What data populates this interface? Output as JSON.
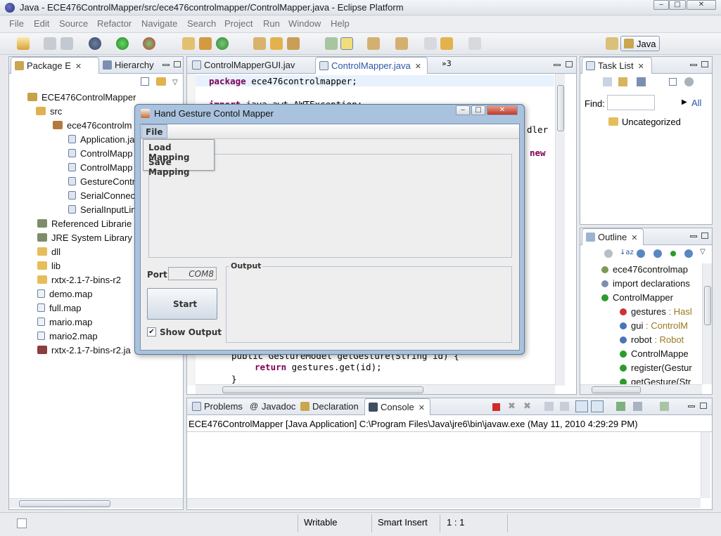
{
  "window": {
    "title": "Java - ECE476ControlMapper/src/ece476controlmapper/ControlMapper.java - Eclipse Platform",
    "min": "‒",
    "max": "□",
    "close": "✕"
  },
  "menubar": [
    "File",
    "Edit",
    "Source",
    "Refactor",
    "Navigate",
    "Search",
    "Project",
    "Run",
    "Window",
    "Help"
  ],
  "perspective": {
    "label": "Java"
  },
  "package_explorer": {
    "tabs": [
      {
        "label": "Package E",
        "close": "✕"
      },
      {
        "label": "Hierarchy"
      }
    ],
    "tree": [
      {
        "label": "ECE476ControlMapper",
        "icon": "project-icon"
      },
      {
        "label": "src",
        "icon": "source-folder-icon"
      },
      {
        "label": "ece476controlm",
        "icon": "package-icon"
      },
      {
        "label": "Application.ja",
        "icon": "java-file-icon"
      },
      {
        "label": "ControlMapp",
        "icon": "java-file-icon"
      },
      {
        "label": "ControlMapp",
        "icon": "java-file-icon"
      },
      {
        "label": "GestureContr",
        "icon": "java-file-icon"
      },
      {
        "label": "SerialConnec",
        "icon": "java-file-icon"
      },
      {
        "label": "SerialInputLin",
        "icon": "java-file-icon"
      },
      {
        "label": "Referenced Librarie",
        "icon": "library-icon"
      },
      {
        "label": "JRE System Library",
        "icon": "library-icon"
      },
      {
        "label": "dll",
        "icon": "folder-icon"
      },
      {
        "label": "lib",
        "icon": "folder-icon"
      },
      {
        "label": "rxtx-2.1-7-bins-r2",
        "icon": "folder-icon"
      },
      {
        "label": "demo.map",
        "icon": "file-icon"
      },
      {
        "label": "full.map",
        "icon": "file-icon"
      },
      {
        "label": "mario.map",
        "icon": "file-icon"
      },
      {
        "label": "mario2.map",
        "icon": "file-icon"
      },
      {
        "label": "rxtx-2.1-7-bins-r2.ja",
        "icon": "jar-icon"
      }
    ]
  },
  "editor": {
    "tabs": [
      {
        "label": "ControlMapperGUI.jav"
      },
      {
        "label": "ControlMapper.java",
        "close": "✕"
      }
    ],
    "overflow": "»3",
    "code": {
      "line1_kw": "package",
      "line1_rest": " ece476controlmapper;",
      "line2_kw": "import",
      "line2_rest": " java.awt.AWTException;",
      "frag_a": "dler",
      "frag_b": "new",
      "line_public": "public GestureModel getGesture(String id) {",
      "line_return_kw": "return",
      "line_return_rest": " gestures.get(id);",
      "line_close": "}"
    }
  },
  "task_list": {
    "tab": "Task List",
    "close": "✕",
    "find_label": "Find:",
    "find_value": "",
    "all_link": "All",
    "item": "Uncategorized"
  },
  "outline": {
    "tab": "Outline",
    "close": "✕",
    "items": [
      {
        "label": "ece476controlmap",
        "suffix": ""
      },
      {
        "label": "import declarations",
        "suffix": ""
      },
      {
        "label": "ControlMapper",
        "suffix": ""
      },
      {
        "label": "gestures",
        "suffix": " : Hasl"
      },
      {
        "label": "gui",
        "suffix": " : ControlM"
      },
      {
        "label": "robot",
        "suffix": " : Robot"
      },
      {
        "label": "ControlMappe",
        "suffix": ""
      },
      {
        "label": "register(Gestur",
        "suffix": ""
      },
      {
        "label": "getGesture(Str",
        "suffix": ""
      }
    ]
  },
  "console": {
    "tabs": [
      {
        "label": "Problems"
      },
      {
        "label": "Javadoc"
      },
      {
        "label": "Declaration"
      },
      {
        "label": "Console",
        "close": "✕"
      }
    ],
    "header": "ECE476ControlMapper [Java Application] C:\\Program Files\\Java\\jre6\\bin\\javaw.exe (May 11, 2010 4:29:29 PM)"
  },
  "status": {
    "writable": "Writable",
    "insert_mode": "Smart Insert",
    "position": "1 : 1"
  },
  "dialog": {
    "title": "Hand Gesture Contol Mapper",
    "menu": "File",
    "menu_items": [
      "Load Mapping",
      "Save Mapping"
    ],
    "port_label": "Port:",
    "port_value": "COM8",
    "output_label": "Output",
    "start_button": "Start",
    "show_output_label": "Show Output",
    "show_output_checked": "✔"
  }
}
